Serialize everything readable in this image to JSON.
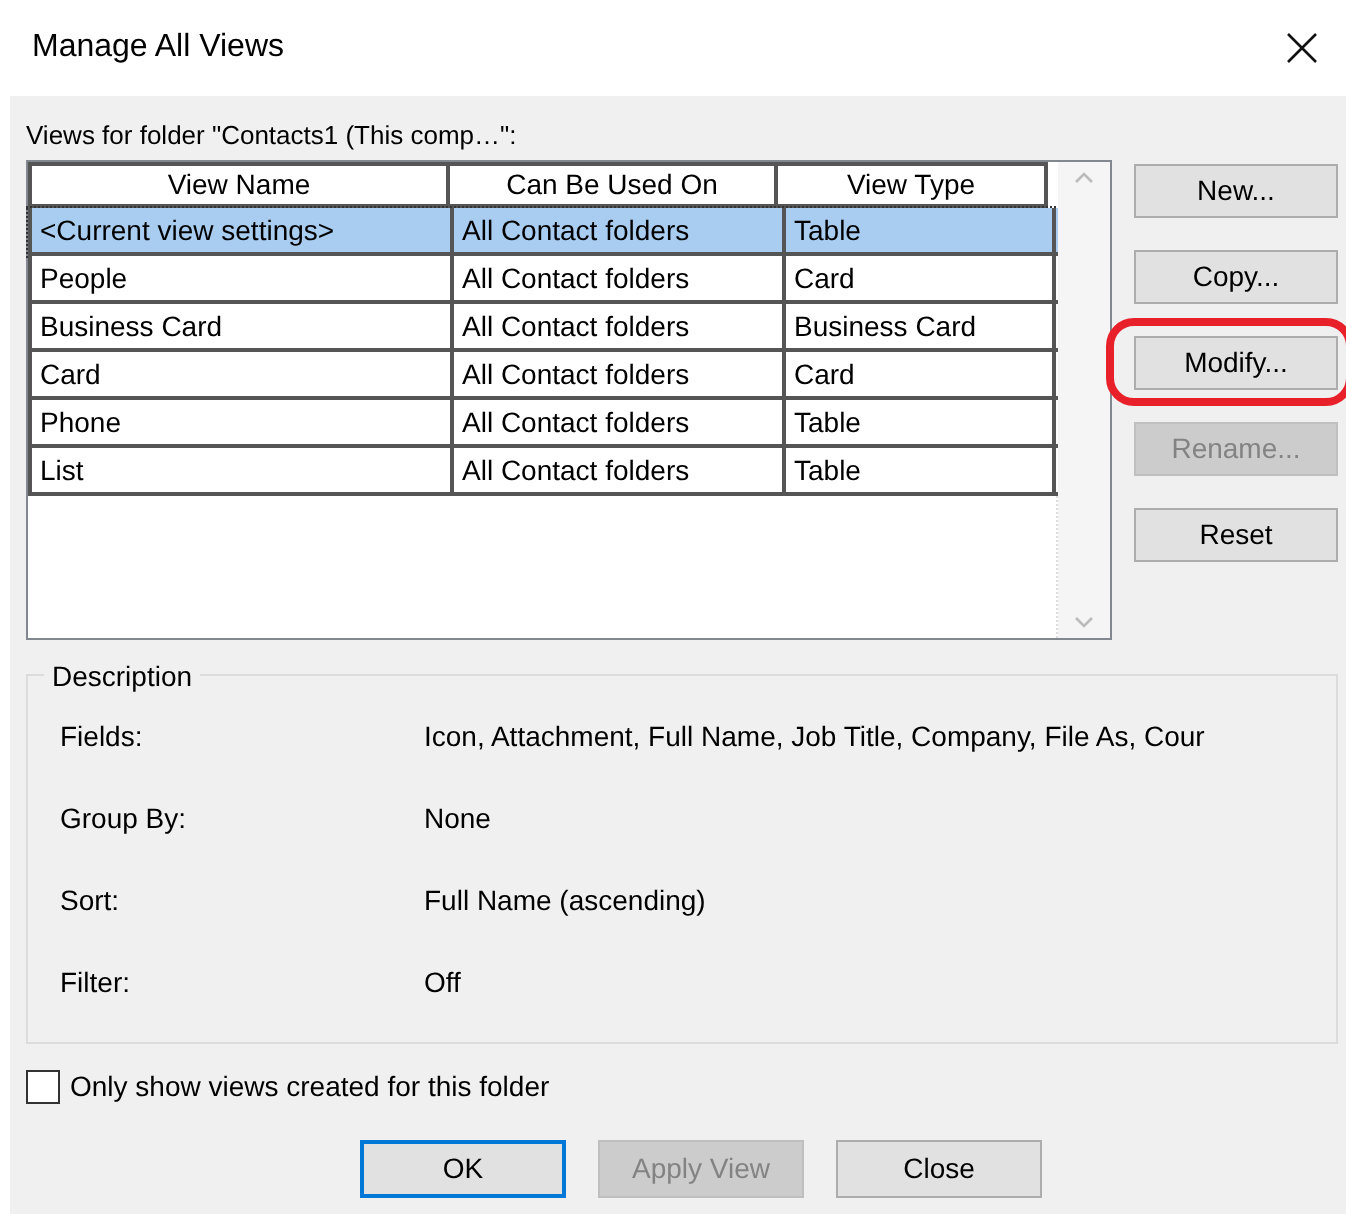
{
  "window": {
    "title": "Manage All Views"
  },
  "views_label": "Views for folder \"Contacts1 (This comp…\":",
  "table": {
    "columns": [
      "View Name",
      "Can Be Used On",
      "View Type"
    ],
    "rows": [
      {
        "cells": [
          "<Current view settings>",
          "All Contact folders",
          "Table"
        ],
        "selected": true
      },
      {
        "cells": [
          "People",
          "All Contact folders",
          "Card"
        ],
        "selected": false
      },
      {
        "cells": [
          "Business Card",
          "All Contact folders",
          "Business Card"
        ],
        "selected": false
      },
      {
        "cells": [
          "Card",
          "All Contact folders",
          "Card"
        ],
        "selected": false
      },
      {
        "cells": [
          "Phone",
          "All Contact folders",
          "Table"
        ],
        "selected": false
      },
      {
        "cells": [
          "List",
          "All Contact folders",
          "Table"
        ],
        "selected": false
      }
    ]
  },
  "side_buttons": [
    {
      "label": "New...",
      "disabled": false,
      "highlighted": false
    },
    {
      "label": "Copy...",
      "disabled": false,
      "highlighted": false
    },
    {
      "label": "Modify...",
      "disabled": false,
      "highlighted": true
    },
    {
      "label": "Rename...",
      "disabled": true,
      "highlighted": false
    },
    {
      "label": "Reset",
      "disabled": false,
      "highlighted": false
    }
  ],
  "description": {
    "title": "Description",
    "items": [
      {
        "label": "Fields:",
        "value": "Icon, Attachment, Full Name, Job Title, Company, File As, Cour"
      },
      {
        "label": "Group By:",
        "value": "None"
      },
      {
        "label": "Sort:",
        "value": "Full Name (ascending)"
      },
      {
        "label": "Filter:",
        "value": "Off"
      }
    ]
  },
  "only_show_checkbox": {
    "label": "Only show views created for this folder",
    "checked": false
  },
  "bottom_buttons": [
    {
      "label": "OK",
      "disabled": false,
      "default": true
    },
    {
      "label": "Apply View",
      "disabled": true,
      "default": false
    },
    {
      "label": "Close",
      "disabled": false,
      "default": false
    }
  ]
}
